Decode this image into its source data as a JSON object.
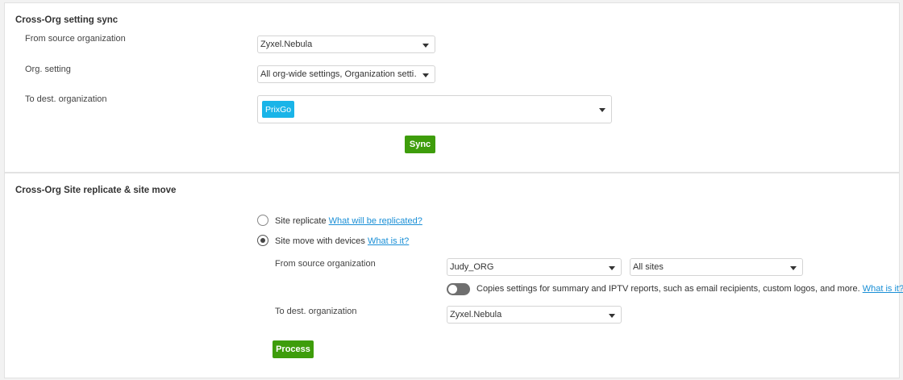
{
  "sync_section": {
    "title": "Cross-Org setting sync",
    "source_label": "From source organization",
    "source_value": "Zyxel.Nebula",
    "org_setting_label": "Org. setting",
    "org_setting_value": "All org-wide settings, Organization setti…",
    "dest_label": "To dest. organization",
    "dest_tag": "PrixGo",
    "sync_button": "Sync"
  },
  "replicate_section": {
    "title": "Cross-Org Site replicate & site move",
    "option_replicate": {
      "label": "Site replicate",
      "link": "What will be replicated?",
      "selected": false
    },
    "option_move": {
      "label": "Site move with devices",
      "link": "What is it?",
      "selected": true
    },
    "source_label": "From source organization",
    "source_value": "Judy_ORG",
    "sites_value": "All sites",
    "copy_toggle": {
      "text": "Copies settings for summary and IPTV reports, such as email recipients, custom logos, and more.",
      "link": "What is it?",
      "on": false
    },
    "dest_label": "To dest. organization",
    "dest_value": "Zyxel.Nebula",
    "process_button": "Process"
  }
}
